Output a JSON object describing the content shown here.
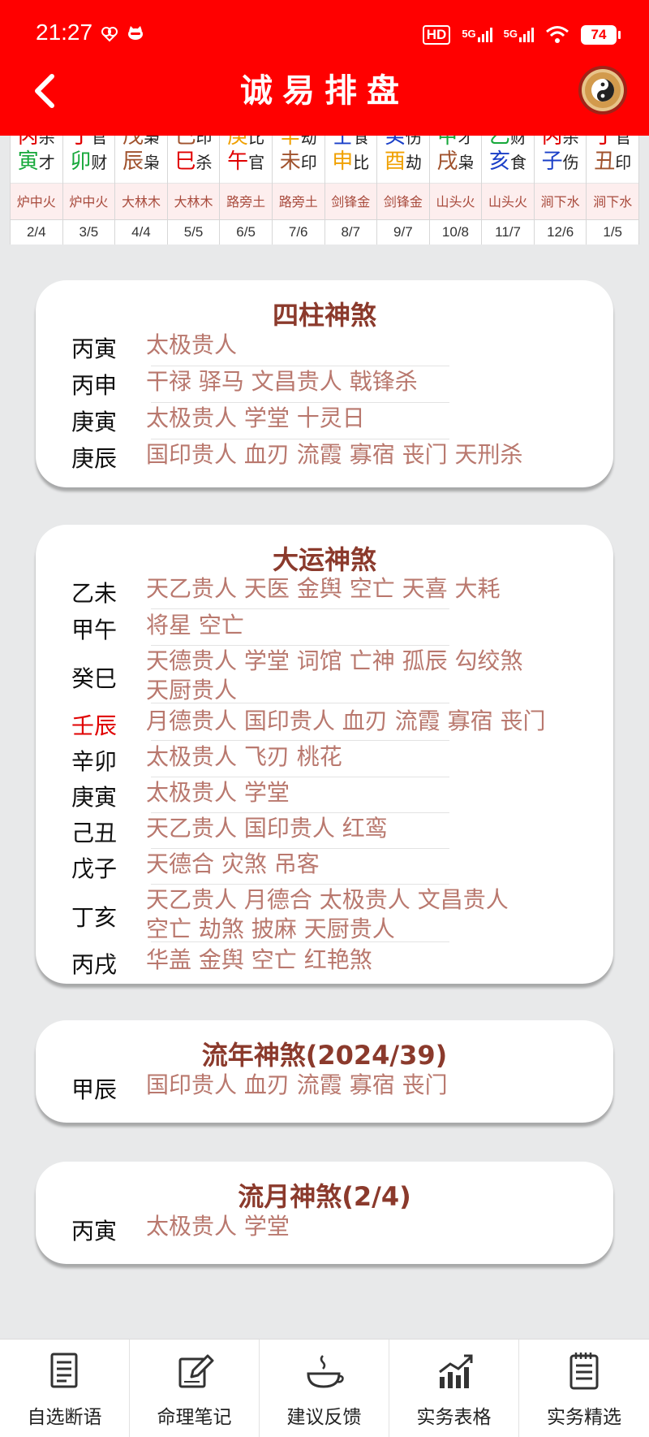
{
  "status_bar": {
    "time": "21:27",
    "hd": "HD",
    "net1": "5G",
    "net2": "5G",
    "battery": "74"
  },
  "nav": {
    "title": "诚易排盘"
  },
  "colors": {
    "header_bg": "#ff0000",
    "card_title": "#8b3a2c",
    "shensha_text": "#b9786e",
    "nayin_text": "#a84a3c",
    "nayin_bg": "#fdeeee",
    "highlight_red": "#e00000"
  },
  "dayun_table": [
    {
      "gan": "丙",
      "gan_shishen": "杀",
      "zhi": "寅",
      "zhi_shishen": "才",
      "gan_color": "#e00000",
      "zhi_color": "#16a83a",
      "nayin": "炉中火",
      "date": "2/4"
    },
    {
      "gan": "丁",
      "gan_shishen": "官",
      "zhi": "卯",
      "zhi_shishen": "财",
      "gan_color": "#e00000",
      "zhi_color": "#16a83a",
      "nayin": "炉中火",
      "date": "3/5"
    },
    {
      "gan": "戊",
      "gan_shishen": "枭",
      "zhi": "辰",
      "zhi_shishen": "枭",
      "gan_color": "#a0522d",
      "zhi_color": "#a0522d",
      "nayin": "大林木",
      "date": "4/4"
    },
    {
      "gan": "己",
      "gan_shishen": "印",
      "zhi": "巳",
      "zhi_shishen": "杀",
      "gan_color": "#a0522d",
      "zhi_color": "#e00000",
      "nayin": "大林木",
      "date": "5/5"
    },
    {
      "gan": "庚",
      "gan_shishen": "比",
      "zhi": "午",
      "zhi_shishen": "官",
      "gan_color": "#f0a000",
      "zhi_color": "#e00000",
      "nayin": "路旁土",
      "date": "6/5"
    },
    {
      "gan": "辛",
      "gan_shishen": "劫",
      "zhi": "未",
      "zhi_shishen": "印",
      "gan_color": "#f0a000",
      "zhi_color": "#a0522d",
      "nayin": "路旁土",
      "date": "7/6"
    },
    {
      "gan": "壬",
      "gan_shishen": "食",
      "zhi": "申",
      "zhi_shishen": "比",
      "gan_color": "#1a3fc8",
      "zhi_color": "#f0a000",
      "nayin": "剑锋金",
      "date": "8/7"
    },
    {
      "gan": "癸",
      "gan_shishen": "伤",
      "zhi": "酉",
      "zhi_shishen": "劫",
      "gan_color": "#1a3fc8",
      "zhi_color": "#f0a000",
      "nayin": "剑锋金",
      "date": "9/7"
    },
    {
      "gan": "甲",
      "gan_shishen": "才",
      "zhi": "戌",
      "zhi_shishen": "枭",
      "gan_color": "#16a83a",
      "zhi_color": "#a0522d",
      "nayin": "山头火",
      "date": "10/8"
    },
    {
      "gan": "乙",
      "gan_shishen": "财",
      "zhi": "亥",
      "zhi_shishen": "食",
      "gan_color": "#16a83a",
      "zhi_color": "#1a3fc8",
      "nayin": "山头火",
      "date": "11/7"
    },
    {
      "gan": "丙",
      "gan_shishen": "杀",
      "zhi": "子",
      "zhi_shishen": "伤",
      "gan_color": "#e00000",
      "zhi_color": "#1a3fc8",
      "nayin": "涧下水",
      "date": "12/6"
    },
    {
      "gan": "丁",
      "gan_shishen": "官",
      "zhi": "丑",
      "zhi_shishen": "印",
      "gan_color": "#e00000",
      "zhi_color": "#a0522d",
      "nayin": "涧下水",
      "date": "1/5"
    }
  ],
  "sizhu_shensha": {
    "title": "四柱神煞",
    "rows": [
      {
        "label": "丙寅",
        "lines": [
          "太极贵人"
        ]
      },
      {
        "label": "丙申",
        "lines": [
          "干禄 驿马 文昌贵人 戟锋杀"
        ]
      },
      {
        "label": "庚寅",
        "lines": [
          "太极贵人 学堂 十灵日"
        ]
      },
      {
        "label": "庚辰",
        "lines": [
          "国印贵人 血刃 流霞 寡宿 丧门 天刑杀"
        ]
      }
    ]
  },
  "dayun_shensha": {
    "title": "大运神煞",
    "rows": [
      {
        "label": "乙未",
        "lines": [
          "天乙贵人 天医 金舆 空亡 天喜 大耗"
        ]
      },
      {
        "label": "甲午",
        "lines": [
          "将星 空亡"
        ]
      },
      {
        "label": "癸巳",
        "lines": [
          "天德贵人 学堂 词馆 亡神 孤辰 勾绞煞",
          "天厨贵人"
        ]
      },
      {
        "label": "壬辰",
        "lines": [
          "月德贵人 国印贵人 血刃 流霞 寡宿 丧门"
        ]
      },
      {
        "label": "辛卯",
        "lines": [
          "太极贵人 飞刃 桃花"
        ]
      },
      {
        "label": "庚寅",
        "lines": [
          "太极贵人 学堂"
        ]
      },
      {
        "label": "己丑",
        "lines": [
          "天乙贵人 国印贵人 红鸾"
        ]
      },
      {
        "label": "戊子",
        "lines": [
          "天德合 灾煞 吊客"
        ]
      },
      {
        "label": "丁亥",
        "lines": [
          "天乙贵人 月德合 太极贵人 文昌贵人",
          "空亡 劫煞 披麻 天厨贵人"
        ]
      },
      {
        "label": "丙戌",
        "lines": [
          "华盖 金舆 空亡 红艳煞"
        ]
      }
    ]
  },
  "liunian_shensha": {
    "title": "流年神煞(2024/39)",
    "rows": [
      {
        "label": "甲辰",
        "lines": [
          "国印贵人 血刃 流霞 寡宿 丧门"
        ]
      }
    ]
  },
  "liuyue_shensha": {
    "title": "流月神煞(2/4)",
    "rows": [
      {
        "label": "丙寅",
        "lines": [
          "太极贵人 学堂"
        ]
      }
    ]
  },
  "bottom_nav": [
    {
      "label": "自选断语",
      "icon": "document-icon"
    },
    {
      "label": "命理笔记",
      "icon": "edit-note-icon"
    },
    {
      "label": "建议反馈",
      "icon": "coffee-cup-icon"
    },
    {
      "label": "实务表格",
      "icon": "chart-icon"
    },
    {
      "label": "实务精选",
      "icon": "clipboard-list-icon"
    }
  ]
}
